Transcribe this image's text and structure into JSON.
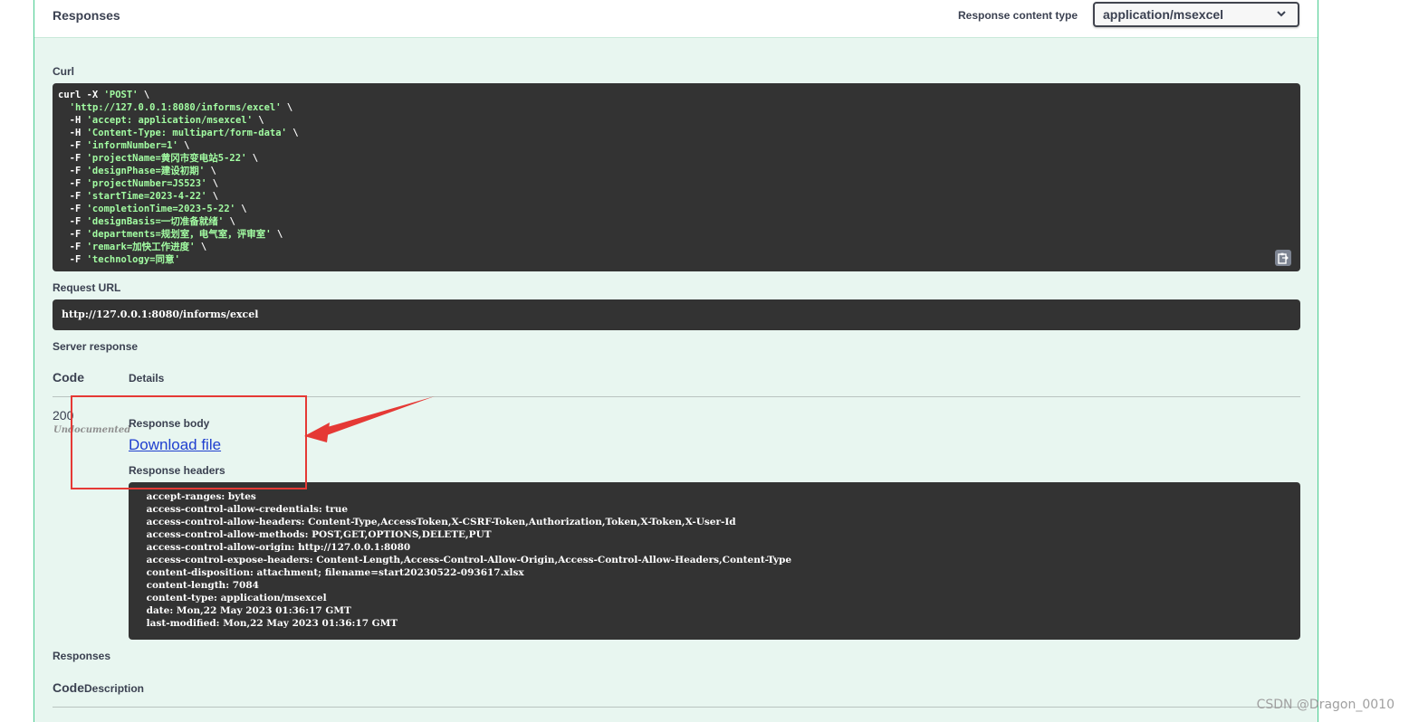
{
  "header": {
    "title": "Responses",
    "content_type_label": "Response content type",
    "content_type_value": "application/msexcel"
  },
  "curl": {
    "label": "Curl",
    "lines": [
      {
        "pre": "curl -X ",
        "str": "'POST'",
        "post": " \\"
      },
      {
        "pre": "  ",
        "str": "'http://127.0.0.1:8080/informs/excel'",
        "post": " \\"
      },
      {
        "pre": "  -H ",
        "str": "'accept: application/msexcel'",
        "post": " \\"
      },
      {
        "pre": "  -H ",
        "str": "'Content-Type: multipart/form-data'",
        "post": " \\"
      },
      {
        "pre": "  -F ",
        "str": "'informNumber=1'",
        "post": " \\"
      },
      {
        "pre": "  -F ",
        "str": "'projectName=黄冈市变电站5-22'",
        "post": " \\"
      },
      {
        "pre": "  -F ",
        "str": "'designPhase=建设初期'",
        "post": " \\"
      },
      {
        "pre": "  -F ",
        "str": "'projectNumber=JS523'",
        "post": " \\"
      },
      {
        "pre": "  -F ",
        "str": "'startTime=2023-4-22'",
        "post": " \\"
      },
      {
        "pre": "  -F ",
        "str": "'completionTime=2023-5-22'",
        "post": " \\"
      },
      {
        "pre": "  -F ",
        "str": "'designBasis=一切准备就绪'",
        "post": " \\"
      },
      {
        "pre": "  -F ",
        "str": "'departments=规划室，电气室，评审室'",
        "post": " \\"
      },
      {
        "pre": "  -F ",
        "str": "'remark=加快工作进度'",
        "post": " \\"
      },
      {
        "pre": "  -F ",
        "str": "'technology=同意'",
        "post": ""
      }
    ]
  },
  "request_url": {
    "label": "Request URL",
    "value": "http://127.0.0.1:8080/informs/excel"
  },
  "server_response": {
    "label": "Server response",
    "col_code": "Code",
    "col_details": "Details",
    "code": "200",
    "undocumented": "Undocumented",
    "body_label": "Response body",
    "download_link": "Download file",
    "headers_label": "Response headers",
    "headers": [
      " accept-ranges: bytes ",
      " access-control-allow-credentials: true ",
      " access-control-allow-headers: Content-Type,AccessToken,X-CSRF-Token,Authorization,Token,X-Token,X-User-Id ",
      " access-control-allow-methods: POST,GET,OPTIONS,DELETE,PUT ",
      " access-control-allow-origin: http://127.0.0.1:8080 ",
      " access-control-expose-headers: Content-Length,Access-Control-Allow-Origin,Access-Control-Allow-Headers,Content-Type ",
      " content-disposition: attachment; filename=start20230522-093617.xlsx ",
      " content-length: 7084 ",
      " content-type: application/msexcel ",
      " date: Mon,22 May 2023 01:36:17 GMT ",
      " last-modified: Mon,22 May 2023 01:36:17 GMT "
    ]
  },
  "responses": {
    "label": "Responses",
    "col_code": "Code",
    "col_description": "Description"
  },
  "watermark": "CSDN @Dragon_0010",
  "colors": {
    "accent": "#49cc90",
    "panel_bg": "#e8f6f0",
    "code_bg": "#333333",
    "string_green": "#a2fca2",
    "annotation_red": "#e53935",
    "link_blue": "#1f3fcf"
  },
  "icons": [
    "chevron-down-icon",
    "copy-to-clipboard-icon",
    "annotation-arrow"
  ]
}
